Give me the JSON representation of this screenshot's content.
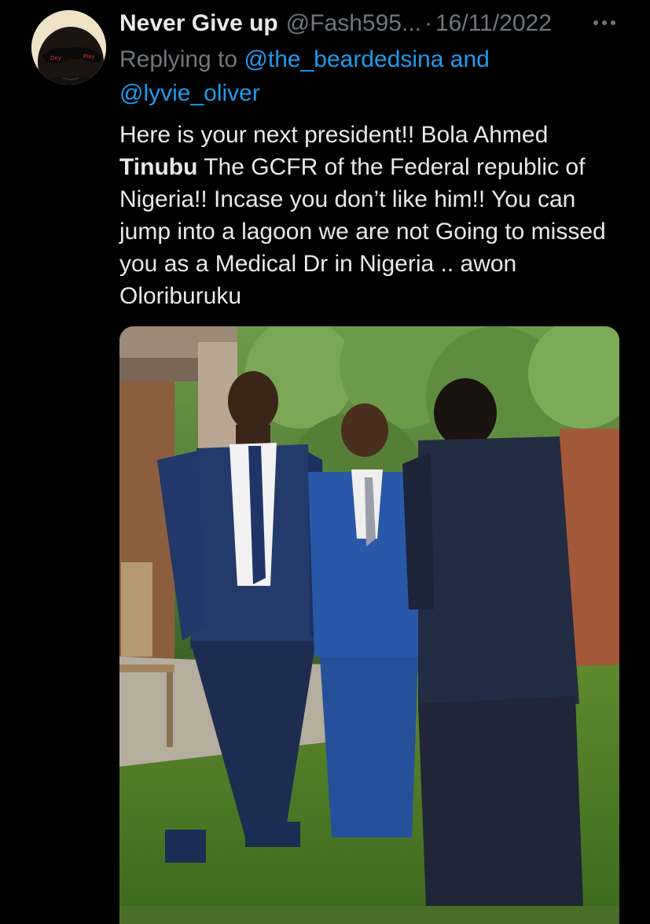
{
  "tweet": {
    "display_name": "Never Give up",
    "handle": "@Fash595...",
    "separator": "·",
    "date": "16/11/2022",
    "reply": {
      "prefix": "Replying to ",
      "mention_1": "@the_beardedsina",
      "connector": " and",
      "mention_2": "@lyvie_oliver"
    },
    "text": {
      "part_1": "Here is your next president!! Bola Ahmed ",
      "bold": "Tinubu",
      "part_2": " The GCFR of the Federal republic of Nigeria!! Incase you don’t like him!! You can jump into a lagoon we are not Going to missed you as  a Medical  Dr in Nigeria .. awon Oloriburuku"
    },
    "avatar": {
      "icon": "profile-avatar",
      "glasses_left_text": "Dey",
      "glasses_right_text": "Play"
    },
    "more_icon": "more-horizontal-icon",
    "media": {
      "icon": "photo-three-men-in-suits-garden"
    }
  },
  "colors": {
    "background": "#000000",
    "primary_text": "#e7e9ea",
    "secondary_text": "#71767b",
    "link": "#1d9bf0"
  }
}
